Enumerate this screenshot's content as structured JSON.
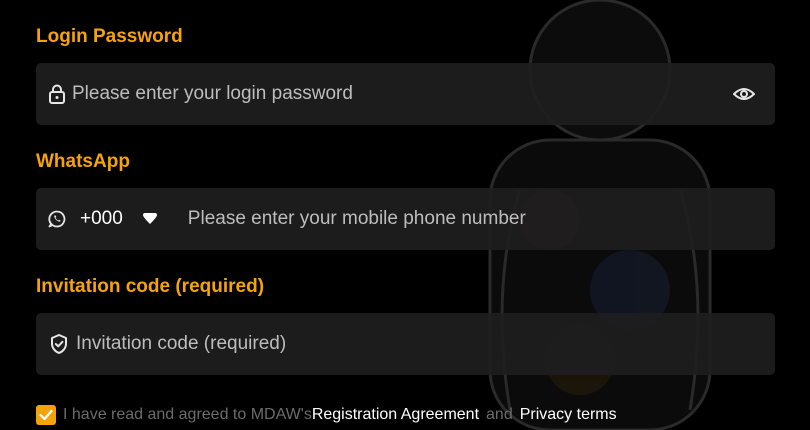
{
  "login_password": {
    "label": "Login Password",
    "placeholder": "Please enter your login password",
    "lock_icon": "lock-icon",
    "toggle_icon": "eye-icon"
  },
  "whatsapp": {
    "label": "WhatsApp",
    "country_code": "+000",
    "placeholder": "Please enter your mobile phone number",
    "whatsapp_icon": "whatsapp-icon",
    "dropdown_icon": "caret-down-icon"
  },
  "invitation": {
    "label": "Invitation code (required)",
    "placeholder": "Invitation code (required)",
    "shield_icon": "shield-check-icon"
  },
  "agreement": {
    "checked": true,
    "prefix": "I have read and agreed to MDAW's",
    "registration_link": "Registration Agreement",
    "and_text": "and",
    "privacy_link": "Privacy terms"
  },
  "colors": {
    "accent": "#f5a30c",
    "background": "#000000",
    "field_bg": "#1e1e20",
    "placeholder": "#bdbdbd"
  }
}
